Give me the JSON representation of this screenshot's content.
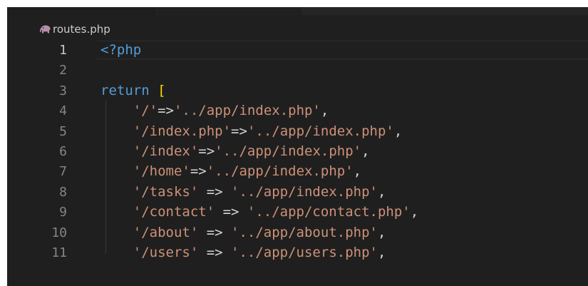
{
  "editor": {
    "file_name": "routes.php",
    "file_icon": "php-elephant-icon",
    "current_line": 1,
    "lines": [
      {
        "number": "1",
        "tokens": [
          {
            "t": "<?php",
            "c": "tag"
          }
        ]
      },
      {
        "number": "2",
        "tokens": []
      },
      {
        "number": "3",
        "tokens": [
          {
            "t": "return ",
            "c": "kw"
          },
          {
            "t": "[",
            "c": "br"
          }
        ]
      },
      {
        "number": "4",
        "tokens": [
          {
            "t": "    ",
            "c": "op"
          },
          {
            "t": "'/'",
            "c": "str"
          },
          {
            "t": "=>",
            "c": "op"
          },
          {
            "t": "'../app/index.php'",
            "c": "str"
          },
          {
            "t": ",",
            "c": "op"
          }
        ]
      },
      {
        "number": "5",
        "tokens": [
          {
            "t": "    ",
            "c": "op"
          },
          {
            "t": "'/index.php'",
            "c": "str"
          },
          {
            "t": "=>",
            "c": "op"
          },
          {
            "t": "'../app/index.php'",
            "c": "str"
          },
          {
            "t": ",",
            "c": "op"
          }
        ]
      },
      {
        "number": "6",
        "tokens": [
          {
            "t": "    ",
            "c": "op"
          },
          {
            "t": "'/index'",
            "c": "str"
          },
          {
            "t": "=>",
            "c": "op"
          },
          {
            "t": "'../app/index.php'",
            "c": "str"
          },
          {
            "t": ",",
            "c": "op"
          }
        ]
      },
      {
        "number": "7",
        "tokens": [
          {
            "t": "    ",
            "c": "op"
          },
          {
            "t": "'/home'",
            "c": "str"
          },
          {
            "t": "=>",
            "c": "op"
          },
          {
            "t": "'../app/index.php'",
            "c": "str"
          },
          {
            "t": ",",
            "c": "op"
          }
        ]
      },
      {
        "number": "8",
        "tokens": [
          {
            "t": "    ",
            "c": "op"
          },
          {
            "t": "'/tasks'",
            "c": "str"
          },
          {
            "t": " => ",
            "c": "op"
          },
          {
            "t": "'../app/index.php'",
            "c": "str"
          },
          {
            "t": ",",
            "c": "op"
          }
        ]
      },
      {
        "number": "9",
        "tokens": [
          {
            "t": "    ",
            "c": "op"
          },
          {
            "t": "'/contact'",
            "c": "str"
          },
          {
            "t": " => ",
            "c": "op"
          },
          {
            "t": "'../app/contact.php'",
            "c": "str"
          },
          {
            "t": ",",
            "c": "op"
          }
        ]
      },
      {
        "number": "10",
        "tokens": [
          {
            "t": "    ",
            "c": "op"
          },
          {
            "t": "'/about'",
            "c": "str"
          },
          {
            "t": " => ",
            "c": "op"
          },
          {
            "t": "'../app/about.php'",
            "c": "str"
          },
          {
            "t": ",",
            "c": "op"
          }
        ]
      },
      {
        "number": "11",
        "tokens": [
          {
            "t": "    ",
            "c": "op"
          },
          {
            "t": "'/users'",
            "c": "str"
          },
          {
            "t": " => ",
            "c": "op"
          },
          {
            "t": "'../app/users.php'",
            "c": "str"
          },
          {
            "t": ",",
            "c": "op"
          }
        ]
      }
    ]
  },
  "colors": {
    "background": "#1f1f1f",
    "php_tag": "#569cd6",
    "keyword": "#569cd6",
    "bracket": "#ffd700",
    "string": "#ce9178",
    "operator": "#d4d4d4",
    "line_number": "#858585",
    "line_number_active": "#c6c6c6"
  }
}
